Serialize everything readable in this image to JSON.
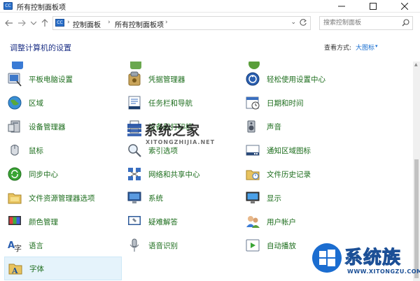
{
  "window": {
    "title": "所有控制面板项",
    "icon_text": "CC"
  },
  "address": {
    "crumbs": [
      "控制面板",
      "所有控制面板项"
    ],
    "search_placeholder": "搜索控制面板"
  },
  "header": {
    "heading": "调整计算机的设置",
    "view_label": "查看方式:",
    "view_value": "大图标",
    "view_caret": "▾"
  },
  "items": [
    {
      "label": "平板电脑设置",
      "icon": "tablet-pc-settings-icon"
    },
    {
      "label": "凭据管理器",
      "icon": "credential-manager-icon"
    },
    {
      "label": "轻松使用设置中心",
      "icon": "ease-of-access-icon"
    },
    {
      "label": "区域",
      "icon": "region-icon"
    },
    {
      "label": "任务栏和导航",
      "icon": "taskbar-navigation-icon"
    },
    {
      "label": "日期和时间",
      "icon": "date-time-icon"
    },
    {
      "label": "设备管理器",
      "icon": "device-manager-icon"
    },
    {
      "label": "设备和打印机",
      "icon": "devices-printers-icon"
    },
    {
      "label": "声音",
      "icon": "sound-icon"
    },
    {
      "label": "鼠标",
      "icon": "mouse-icon"
    },
    {
      "label": "索引选项",
      "icon": "indexing-options-icon"
    },
    {
      "label": "通知区域图标",
      "icon": "notification-area-icons-icon"
    },
    {
      "label": "同步中心",
      "icon": "sync-center-icon"
    },
    {
      "label": "网络和共享中心",
      "icon": "network-sharing-icon"
    },
    {
      "label": "文件历史记录",
      "icon": "file-history-icon"
    },
    {
      "label": "文件资源管理器选项",
      "icon": "file-explorer-options-icon"
    },
    {
      "label": "系统",
      "icon": "system-icon"
    },
    {
      "label": "显示",
      "icon": "display-icon"
    },
    {
      "label": "颜色管理",
      "icon": "color-management-icon"
    },
    {
      "label": "疑难解答",
      "icon": "troubleshooting-icon"
    },
    {
      "label": "用户帐户",
      "icon": "user-accounts-icon"
    },
    {
      "label": "语言",
      "icon": "language-icon"
    },
    {
      "label": "语音识别",
      "icon": "speech-recognition-icon"
    },
    {
      "label": "自动播放",
      "icon": "autoplay-icon"
    },
    {
      "label": "字体",
      "icon": "fonts-icon"
    }
  ],
  "watermark": {
    "center_text": "系统之家",
    "center_sub": "XITONGZHIJIA.NET",
    "corner_text": "系统族",
    "corner_sub": "WWW.XITONGZU.COM"
  },
  "colors": {
    "link_green": "#1e6e1e",
    "heading_blue": "#1e3287",
    "accent_blue": "#1a6fd1",
    "selection": "#e5f3fb"
  }
}
